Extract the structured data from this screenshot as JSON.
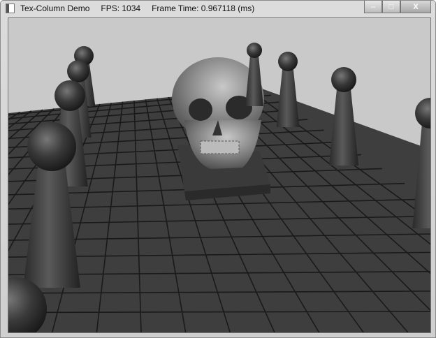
{
  "window": {
    "app_name": "Tex-Column Demo",
    "fps": "FPS: 1034",
    "frame_time": "Frame Time: 0.967118 (ms)",
    "controls": {
      "minimize": "–",
      "maximize": "□",
      "close": "X"
    }
  },
  "colors": {
    "sky": "#c9c9c9",
    "floor": "#3e3e3e",
    "grid": "#1a1a1a"
  }
}
